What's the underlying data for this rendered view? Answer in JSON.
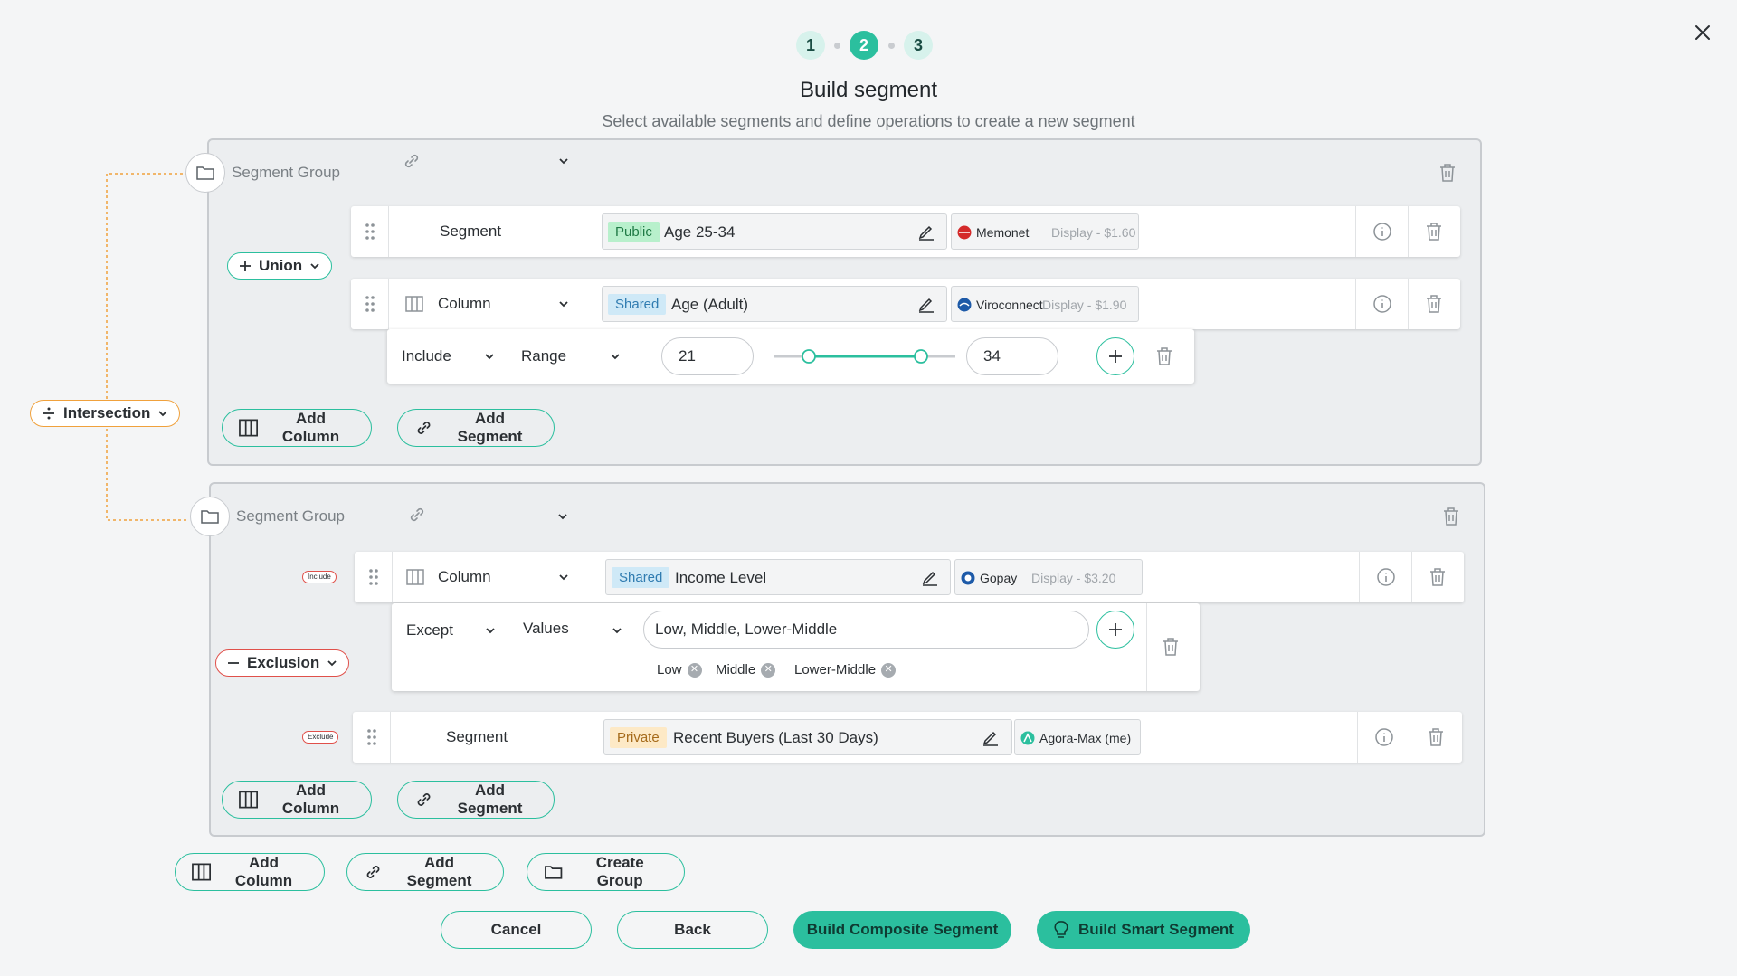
{
  "stepper": {
    "steps": [
      "1",
      "2",
      "3"
    ],
    "active_step": 2
  },
  "header": {
    "title": "Build segment",
    "subtitle": "Select available segments and define operations to create a new segment"
  },
  "operators": {
    "root": "Intersection",
    "group1": "Union",
    "group2": "Exclusion",
    "tag_include": "Include",
    "tag_exclude": "Exclude"
  },
  "group1": {
    "label": "Segment Group",
    "rows": [
      {
        "type_label": "Segment",
        "badge": "Public",
        "name": "Age 25-34",
        "provider": "Memonet",
        "price": "Display - $1.60"
      },
      {
        "type_label": "Column",
        "badge": "Shared",
        "name": "Age (Adult)",
        "provider": "Viroconnect",
        "price": "Display - $1.90"
      }
    ],
    "filter": {
      "mode": "Include",
      "op": "Range",
      "min": "21",
      "max": "34",
      "slider_min_fraction": 0.19,
      "slider_max_fraction": 0.81
    },
    "add_column": "Add Column",
    "add_segment": "Add Segment"
  },
  "group2": {
    "label": "Segment Group",
    "rows": [
      {
        "type_label": "Column",
        "badge": "Shared",
        "name": "Income Level",
        "provider": "Gopay",
        "price": "Display - $3.20"
      },
      {
        "type_label": "Segment",
        "badge": "Private",
        "name": "Recent Buyers (Last 30 Days)",
        "provider": "Agora-Max (me)",
        "price": ""
      }
    ],
    "filter": {
      "mode": "Except",
      "op": "Values",
      "value": "Low, Middle, Lower-Middle",
      "chips": [
        "Low",
        "Middle",
        "Lower-Middle"
      ]
    },
    "add_column": "Add Column",
    "add_segment": "Add Segment"
  },
  "bottom_actions": {
    "add_column": "Add Column",
    "add_segment": "Add Segment",
    "create_group": "Create Group"
  },
  "footer": {
    "cancel": "Cancel",
    "back": "Back",
    "build_composite": "Build Composite Segment",
    "build_smart": "Build Smart Segment"
  },
  "colors": {
    "accent": "#2bbf9e",
    "intersection": "#f0a13c",
    "union": "#2bbf9e",
    "exclusion": "#e0504a"
  }
}
